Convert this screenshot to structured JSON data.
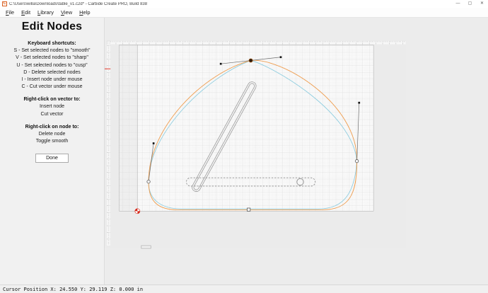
{
  "window": {
    "title": "C:\\Users\\willa\\Downloads\\table_v1.c2d* - Carbide Create PRO, Build 838",
    "icon_letter": "C",
    "controls": {
      "minimize": "—",
      "maximize": "▢",
      "close": "✕"
    }
  },
  "menu": {
    "items": [
      "File",
      "Edit",
      "Library",
      "View",
      "Help"
    ]
  },
  "panel": {
    "title": "Edit Nodes",
    "sections": [
      {
        "heading": "Keyboard shortcuts:",
        "lines": [
          "S - Set selected nodes to \"smooth\"",
          "V - Set selected nodes to \"sharp\"",
          "U - Set selected nodes to \"cusp\"",
          "D - Delete selected nodes",
          "I - Insert node under mouse",
          "C - Cut vector under mouse"
        ]
      },
      {
        "heading": "Right-click on vector to:",
        "lines": [
          "Insert node",
          "Cut vector"
        ]
      },
      {
        "heading": "Right-click on node to:",
        "lines": [
          "Delete node",
          "Toggle smooth"
        ]
      }
    ],
    "done_label": "Done"
  },
  "canvas": {
    "colors": {
      "edited_path_orange": "#ef9f52",
      "original_path_cyan": "#8cccе0",
      "geometry_gray": "#9a9a9a",
      "origin_marker_red": "#d6281a",
      "ruler_cursor_red": "#e23b2e"
    },
    "elements": [
      "stock-grid",
      "tabletop-outline-cyan",
      "tabletop-outline-orange",
      "slanted-slot",
      "dashed-slot",
      "dashed-slot-circle",
      "smooth-node-selected",
      "node-right",
      "node-left",
      "node-bottom",
      "origin-marker"
    ]
  },
  "statusbar": {
    "text": "Cursor Position X: 24.550 Y: 29.119 Z: 0.000 in"
  }
}
